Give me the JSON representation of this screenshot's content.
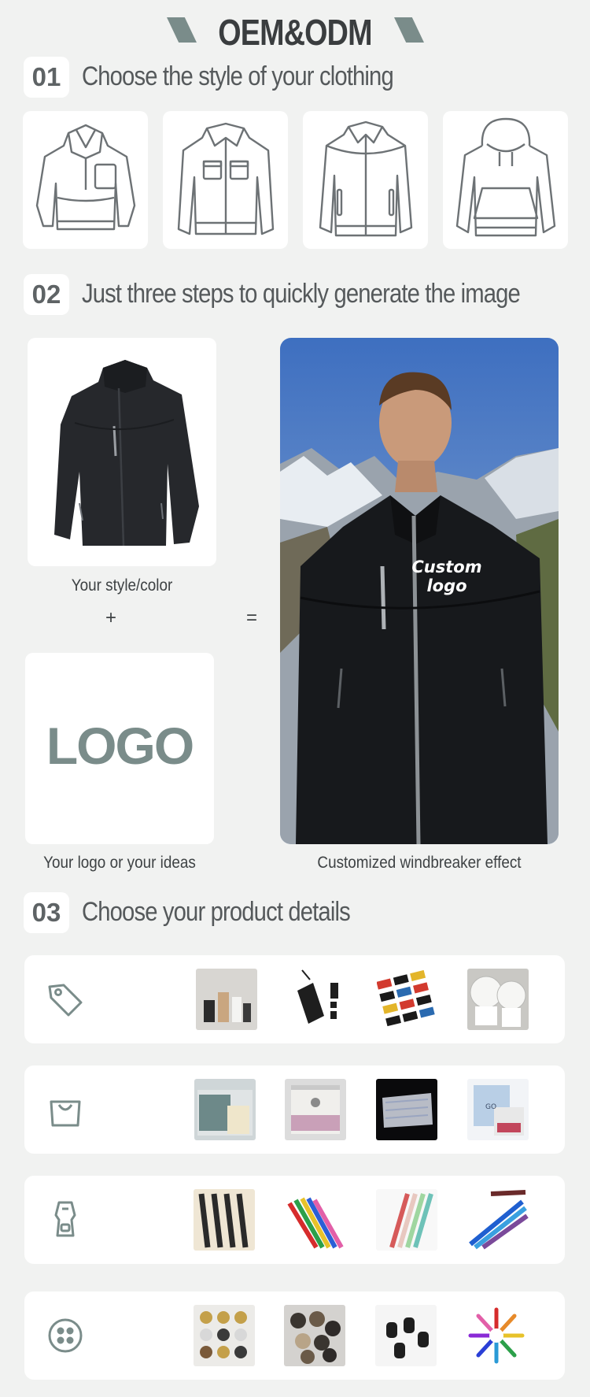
{
  "header": {
    "title": "OEM&ODM",
    "accent_color": "#7a8c8a"
  },
  "steps": [
    {
      "number": "01",
      "title": "Choose the style of your clothing"
    },
    {
      "number": "02",
      "title": "Just three steps to quickly generate the image"
    },
    {
      "number": "03",
      "title": "Choose your product details"
    }
  ],
  "styles": [
    {
      "icon": "fleece-pullover-icon"
    },
    {
      "icon": "work-jacket-icon"
    },
    {
      "icon": "zip-jacket-icon"
    },
    {
      "icon": "hoodie-icon"
    }
  ],
  "composer": {
    "style_caption": "Your style/color",
    "plus": "+",
    "equals": "=",
    "logo_text": "LOGO",
    "logo_caption": "Your logo or your ideas",
    "result_caption": "Customized windbreaker effect",
    "overlay_text_line1": "Custom",
    "overlay_text_line2": "logo"
  },
  "details": [
    {
      "icon": "tag-icon",
      "thumbs": [
        "hangtag-set-photo",
        "black-hangtag-photo",
        "woven-labels-photo",
        "label-rolls-photo"
      ]
    },
    {
      "icon": "bag-icon",
      "thumbs": [
        "clear-packaging-photo",
        "zip-bag-photo",
        "printed-poly-bag-photo",
        "mailer-bag-photo"
      ]
    },
    {
      "icon": "zipper-icon",
      "thumbs": [
        "black-zippers-photo",
        "colorful-zippers-photo",
        "pastel-zippers-photo",
        "blue-zippers-photo"
      ]
    },
    {
      "icon": "button-icon",
      "thumbs": [
        "metal-buttons-photo",
        "horn-buttons-photo",
        "cord-stoppers-photo",
        "color-wheel-buttons-photo"
      ]
    }
  ]
}
